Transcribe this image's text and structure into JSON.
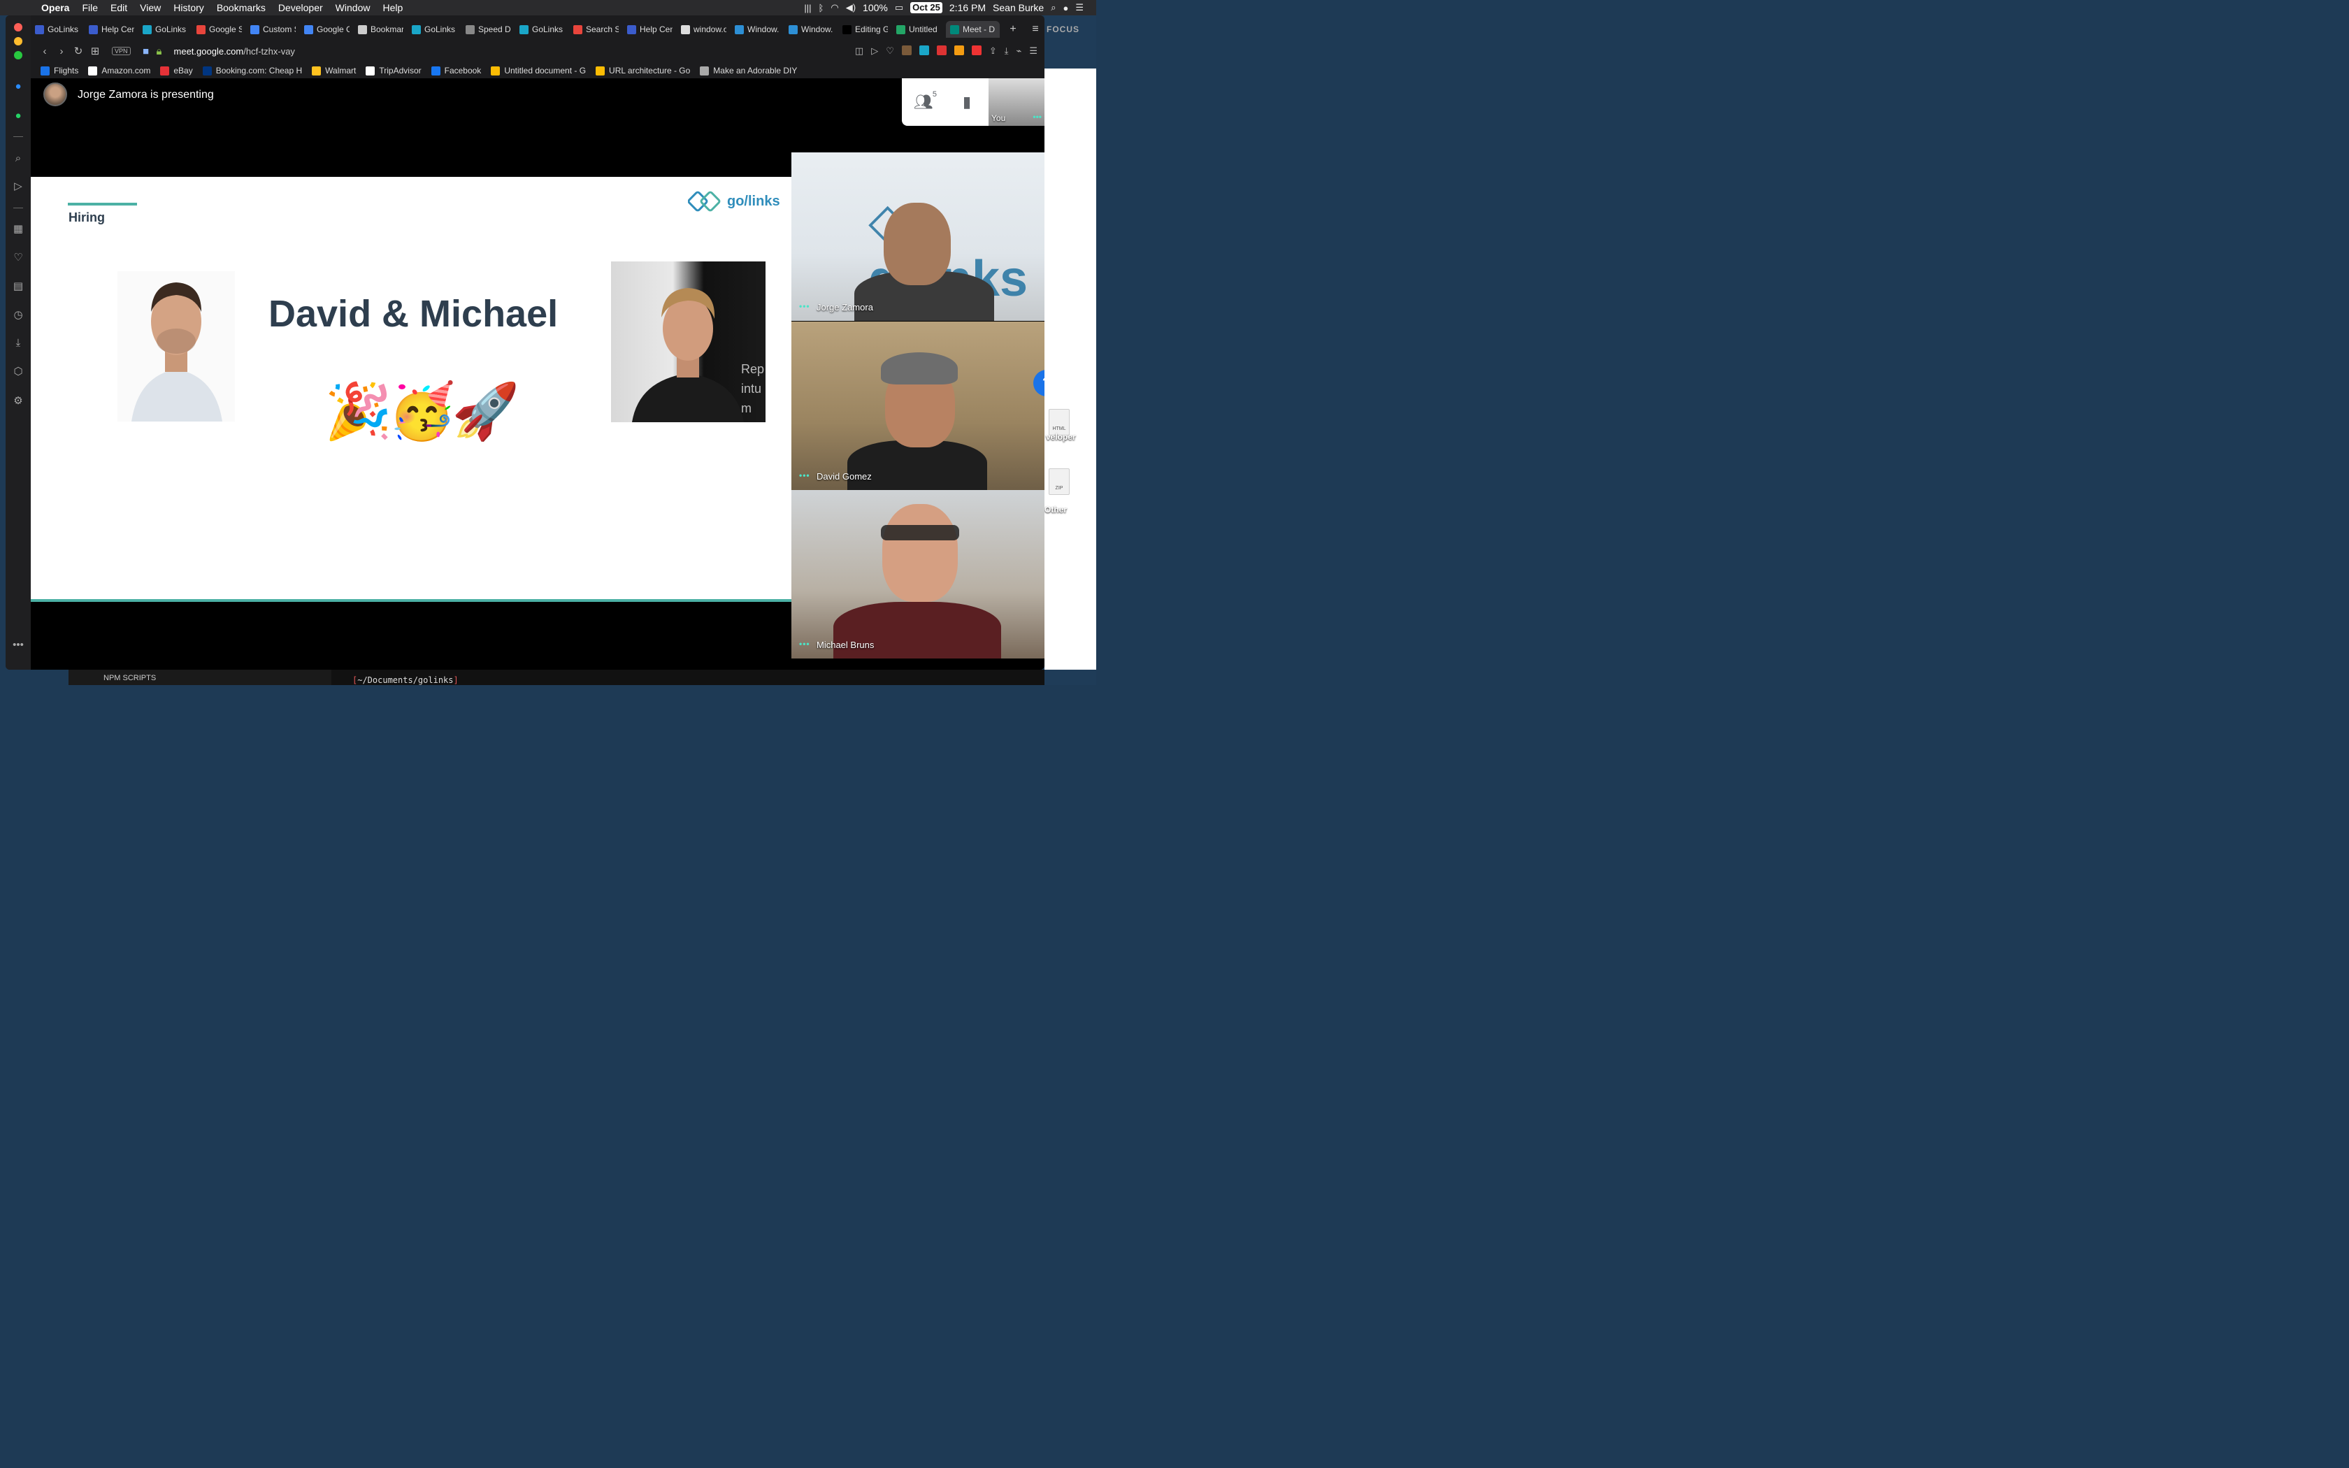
{
  "menubar": {
    "app": "Opera",
    "items": [
      "File",
      "Edit",
      "View",
      "History",
      "Bookmarks",
      "Developer",
      "Window",
      "Help"
    ],
    "battery": "100%",
    "date": "Oct 25",
    "time": "2:16 PM",
    "user": "Sean Burke"
  },
  "tabs": [
    {
      "label": "GoLinks",
      "color": "#3b5ccc"
    },
    {
      "label": "Help Cen",
      "color": "#3b5ccc"
    },
    {
      "label": "GoLinks",
      "color": "#1aa6c8"
    },
    {
      "label": "Google S",
      "color": "#e8453c"
    },
    {
      "label": "Custom S",
      "color": "#4285f4"
    },
    {
      "label": "Google C",
      "color": "#4285f4"
    },
    {
      "label": "Bookmar",
      "color": "#cccccc"
    },
    {
      "label": "GoLinks",
      "color": "#1aa6c8"
    },
    {
      "label": "Speed Di",
      "color": "#888888"
    },
    {
      "label": "GoLinks",
      "color": "#1aa6c8"
    },
    {
      "label": "Search S",
      "color": "#e8453c"
    },
    {
      "label": "Help Cen",
      "color": "#3b5ccc"
    },
    {
      "label": "window.o",
      "color": "#dddddd"
    },
    {
      "label": "Window.",
      "color": "#2d8fd5"
    },
    {
      "label": "Window.",
      "color": "#2d8fd5"
    },
    {
      "label": "Editing G",
      "color": "#000000"
    },
    {
      "label": "Untitled",
      "color": "#23a566"
    },
    {
      "label": "Meet - D",
      "color": "#00897b"
    }
  ],
  "address": {
    "vpn": "VPN",
    "url_host": "meet.google.com",
    "url_path": "/hcf-tzhx-vay"
  },
  "bookmarks": [
    {
      "label": "Flights",
      "color": "#1a73e8"
    },
    {
      "label": "Amazon.com",
      "color": "#ffffff"
    },
    {
      "label": "eBay",
      "color": "#e53238"
    },
    {
      "label": "Booking.com: Cheap H",
      "color": "#003580"
    },
    {
      "label": "Walmart",
      "color": "#ffc220"
    },
    {
      "label": "TripAdvisor",
      "color": "#ffffff"
    },
    {
      "label": "Facebook",
      "color": "#1877f2"
    },
    {
      "label": "Untitled document - G",
      "color": "#fbbc04"
    },
    {
      "label": "URL architecture - Go",
      "color": "#fbbc04"
    },
    {
      "label": "Make an Adorable DIY",
      "color": "#aaaaaa"
    }
  ],
  "meet": {
    "presenting_text": "Jorge Zamora is presenting",
    "participant_count": "5",
    "self_label": "You",
    "help": "?",
    "participants": [
      "Jorge Zamora",
      "David Gomez",
      "Michael Bruns"
    ]
  },
  "slide": {
    "section": "Hiring",
    "logo_text": "go/links",
    "headline": "David & Michael",
    "emojis": "🎉🥳🚀",
    "badge_text": "Rep\nintu\nm"
  },
  "desktop": {
    "focus": "FOCUS",
    "labels": [
      "veloper",
      "Other"
    ],
    "file_types": [
      "HTML",
      "ZIP"
    ]
  },
  "bottom": {
    "npm": "NPM SCRIPTS",
    "terminal": "~/Documents/golinks"
  },
  "colors": {
    "accent_teal": "#4cb1a5",
    "slide_text": "#2e3e4e",
    "logo_blue": "#2f8dbb"
  }
}
